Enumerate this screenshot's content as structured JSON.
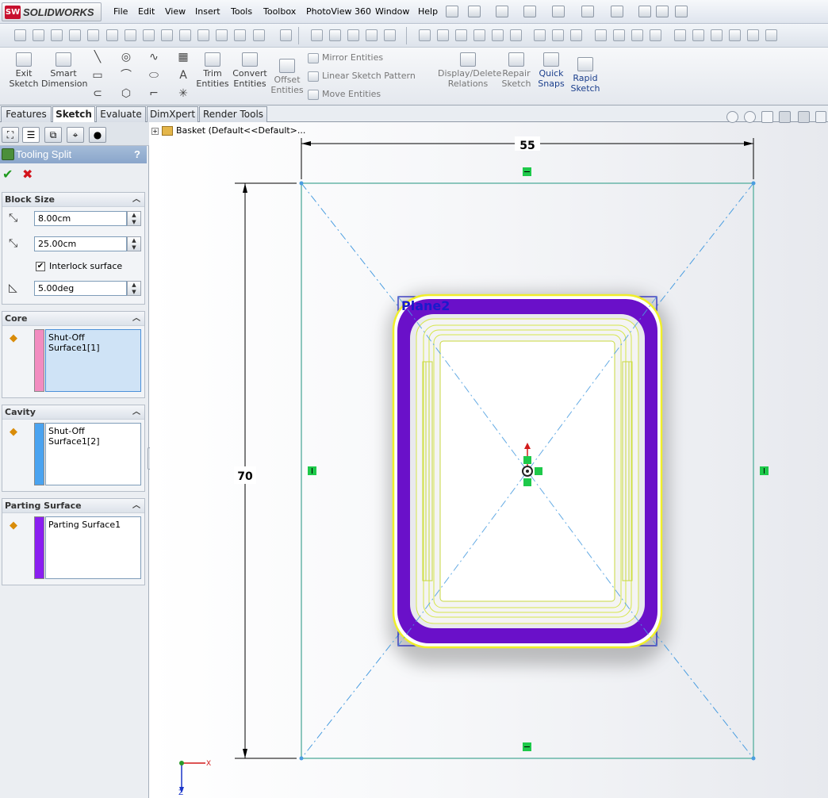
{
  "app": {
    "logo_text": "SOLIDWORKS",
    "logo_mark": "SW"
  },
  "menu": [
    "File",
    "Edit",
    "View",
    "Insert",
    "Tools",
    "Toolbox",
    "PhotoView 360",
    "Window",
    "Help"
  ],
  "command_manager": {
    "exit_sketch": [
      "Exit",
      "Sketch"
    ],
    "smart_dimension": [
      "Smart",
      "Dimension"
    ],
    "trim_entities": [
      "Trim",
      "Entities"
    ],
    "convert_entities": [
      "Convert",
      "Entities"
    ],
    "offset_entities": [
      "Offset",
      "Entities"
    ],
    "mirror_entities": "Mirror Entities",
    "linear_sketch_pattern": "Linear Sketch Pattern",
    "move_entities": "Move Entities",
    "display_delete_relations": [
      "Display/Delete",
      "Relations"
    ],
    "repair_sketch": [
      "Repair",
      "Sketch"
    ],
    "quick_snaps": [
      "Quick",
      "Snaps"
    ],
    "rapid_sketch": [
      "Rapid",
      "Sketch"
    ]
  },
  "tabs": [
    "Features",
    "Sketch",
    "Evaluate",
    "DimXpert",
    "Render Tools"
  ],
  "active_tab": "Sketch",
  "property_manager": {
    "title": "Tooling Split",
    "help": "?",
    "block_size": {
      "heading": "Block Size",
      "depth1": "8.00cm",
      "depth2": "25.00cm",
      "interlock_label": "Interlock surface",
      "interlock_checked": true,
      "draft_angle": "5.00deg"
    },
    "core": {
      "heading": "Core",
      "item": "Shut-Off Surface1[1]",
      "color": "#f28cc0"
    },
    "cavity": {
      "heading": "Cavity",
      "item": "Shut-Off Surface1[2]",
      "color": "#4aa3f0"
    },
    "parting_surface": {
      "heading": "Parting Surface",
      "item": "Parting Surface1",
      "color": "#8a1ef0"
    }
  },
  "tree": {
    "root_label": "Basket  (Default<<Default>..."
  },
  "sketch": {
    "width_dimension": "55",
    "height_dimension": "70",
    "plane_label": "Plane2",
    "axis_x": "X",
    "axis_z": "Z"
  }
}
